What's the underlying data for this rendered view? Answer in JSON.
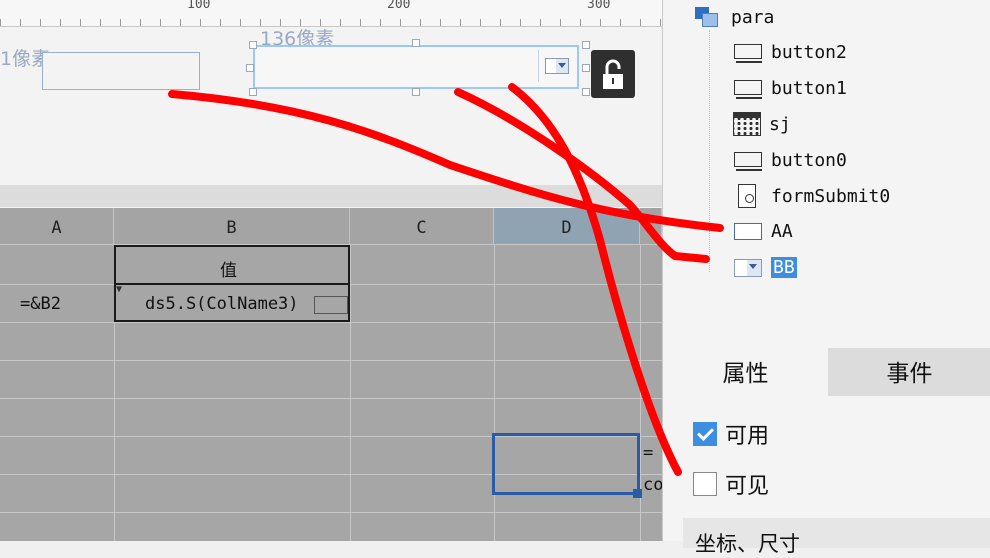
{
  "ruler": {
    "labels": [
      "100",
      "200",
      "300"
    ]
  },
  "design": {
    "aa_width_label": "1像素",
    "bb_width_label": "136像素",
    "lock_icon": "unlock-icon"
  },
  "grid": {
    "columns": [
      "A",
      "B",
      "C",
      "D"
    ],
    "cells": {
      "b1": "值",
      "a2": "=&B2",
      "b2": "ds5.S(ColName3)",
      "overflow_1": "=",
      "overflow_2": "co"
    }
  },
  "widget_tree": {
    "root": "para",
    "items": [
      {
        "label": "button2",
        "icon": "button-icon"
      },
      {
        "label": "button1",
        "icon": "button-icon"
      },
      {
        "label": "sj",
        "icon": "calendar-icon"
      },
      {
        "label": "button0",
        "icon": "button-icon"
      },
      {
        "label": "formSubmit0",
        "icon": "form-submit-icon"
      },
      {
        "label": "AA",
        "icon": "label-icon"
      },
      {
        "label": "BB",
        "icon": "combo-box-icon",
        "selected": true
      }
    ]
  },
  "property_panel": {
    "tabs": [
      "属性",
      "事件"
    ],
    "active_tab": "属性",
    "checkboxes": [
      {
        "label": "可用",
        "checked": true
      },
      {
        "label": "可见",
        "checked": false
      }
    ],
    "section_title": "坐标、尺寸"
  },
  "colors": {
    "annotation_red": "#ff0000",
    "selection_blue": "#3d8de0",
    "grid_selection": "#2b5aa6"
  }
}
